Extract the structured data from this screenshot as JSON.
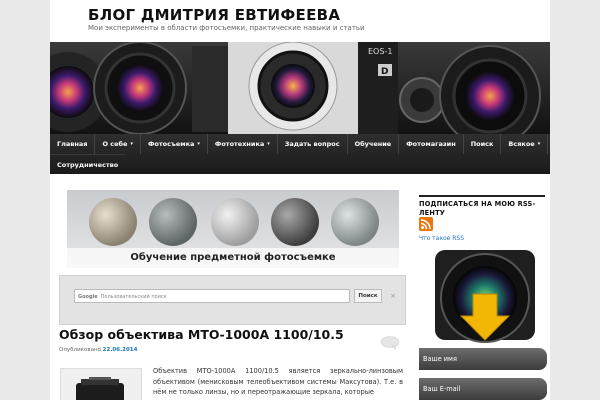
{
  "header": {
    "site_title": "БЛОГ ДМИТРИЯ ЕВТИФЕЕВА",
    "site_description": "Мои эксперименты в области фотосъемки, практические навыки и статьи"
  },
  "nav": {
    "row1": [
      {
        "label": "Главная",
        "has_arrow": false
      },
      {
        "label": "О себе",
        "has_arrow": true
      },
      {
        "label": "Фотосъемка",
        "has_arrow": true
      },
      {
        "label": "Фототехника",
        "has_arrow": true
      },
      {
        "label": "Задать вопрос",
        "has_arrow": false
      },
      {
        "label": "Обучение",
        "has_arrow": false
      },
      {
        "label": "Фотомагазин",
        "has_arrow": false
      },
      {
        "label": "Поиск",
        "has_arrow": false
      },
      {
        "label": "Всякое",
        "has_arrow": true
      }
    ],
    "row2": [
      {
        "label": "Сотрудничество",
        "has_arrow": false
      }
    ],
    "arrow_glyph": "▾"
  },
  "promo": {
    "caption": "Обучение предметной фотосъемке"
  },
  "search": {
    "placeholder": "Пользовательский поиск",
    "logo_text": "Google",
    "button_label": "Поиск",
    "clear_glyph": "×"
  },
  "post": {
    "title": "Обзор объектива МТО-1000А 1100/10.5",
    "meta_prefix": "Опубликовано",
    "date": "22.06.2014",
    "excerpt": "Объектив МТО-1000А 1100/10.5 является зеркально-линзовым объективом (мениcковым телеобъективом системы Максутова). Т.е. в нём не только линзы, но и переотражающие зеркала, которые"
  },
  "sidebar": {
    "subscribe_title": "ПОДПИСАТЬСЯ НА МОЮ RSS-ЛЕНТУ",
    "rss_link": "Что такое RSS",
    "name_field": "Ваше имя",
    "email_field": "Ваш E-mail"
  },
  "colors": {
    "accent_link": "#1e73be",
    "nav_bg": "#1f1f1f",
    "rss_orange": "#e06a0c",
    "arrow_yellow": "#f2b705"
  }
}
